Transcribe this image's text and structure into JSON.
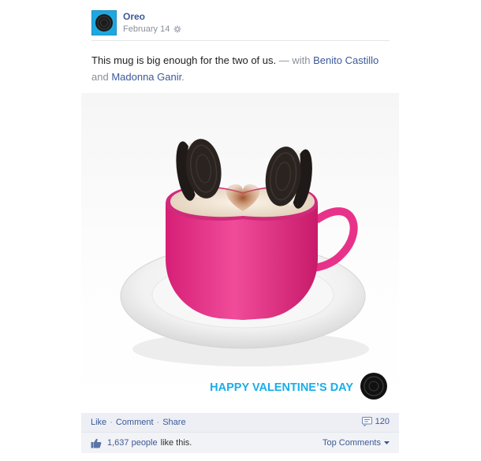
{
  "post": {
    "author": "Oreo",
    "date": "February 14",
    "privacy_icon": "gear-icon",
    "caption": {
      "text": "This mug is big enough for the two of us.",
      "with_prefix": "— with",
      "tag1": "Benito Castillo",
      "and_word": "and",
      "tag2": "Madonna Ganir",
      "end": "."
    },
    "photo": {
      "banner": "HAPPY VALENTINE’S DAY",
      "banner_color": "#1aaee8",
      "mug_color": "#e8328a"
    }
  },
  "actions": {
    "like": "Like",
    "comment": "Comment",
    "share": "Share",
    "separator": "·",
    "comment_count": "120"
  },
  "likes": {
    "count_text": "1,637 people",
    "suffix": "like this.",
    "top_comments": "Top Comments"
  }
}
